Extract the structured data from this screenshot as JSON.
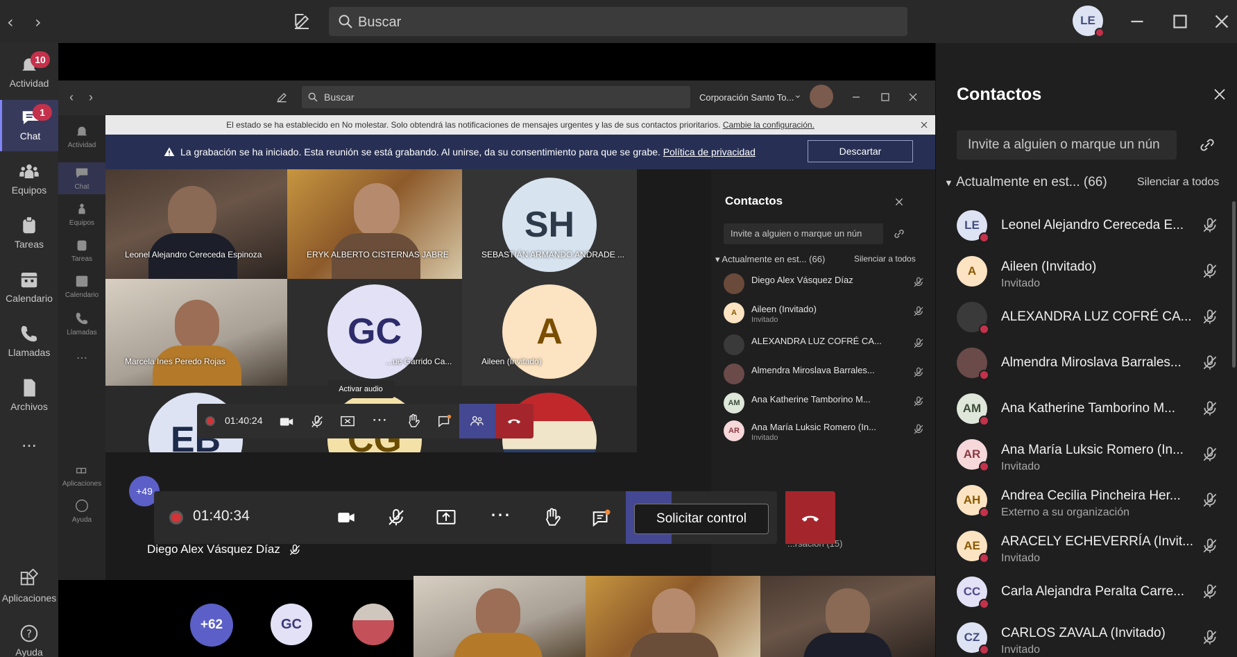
{
  "titlebar": {
    "search_placeholder": "Buscar",
    "user_initials": "LE"
  },
  "rail": {
    "items": [
      {
        "label": "Actividad",
        "icon": "bell-icon",
        "badge": "10"
      },
      {
        "label": "Chat",
        "icon": "chat-icon",
        "badge": "1"
      },
      {
        "label": "Equipos",
        "icon": "teams-icon",
        "badge": ""
      },
      {
        "label": "Tareas",
        "icon": "tasks-icon",
        "badge": ""
      },
      {
        "label": "Calendario",
        "icon": "calendar-icon",
        "badge": ""
      },
      {
        "label": "Llamadas",
        "icon": "phone-icon",
        "badge": ""
      },
      {
        "label": "Archivos",
        "icon": "files-icon",
        "badge": ""
      }
    ],
    "more": "...",
    "apps_label": "Aplicaciones",
    "help_label": "Ayuda"
  },
  "inner": {
    "search_placeholder": "Buscar",
    "org_name": "Corporación Santo To...",
    "rail": [
      "Actividad",
      "Chat",
      "Equipos",
      "Tareas",
      "Calendario",
      "Llamadas"
    ],
    "rail_apps": "Aplicaciones",
    "rail_help": "Ayuda",
    "dnd_text": "El estado se ha establecido en No molestar. Solo obtendrá las notificaciones de mensajes urgentes y las de sus contactos prioritarios.",
    "dnd_link": "Cambie la configuración.",
    "rec_bold": "La grabación se ha iniciado.",
    "rec_text": "Esta reunión se está grabando. Al unirse, da su consentimiento para que se grabe.",
    "rec_link": "Política de privacidad",
    "rec_button": "Descartar",
    "tiles": [
      {
        "name": "Leonel Alejandro Cereceda Espinoza"
      },
      {
        "name": "ERYK ALBERTO CISTERNAS JABRE"
      },
      {
        "name": "SEBASTIÁN ARMANDO ANDRADE ...",
        "initials": "SH"
      },
      {
        "name": "Marcela Ines Peredo Rojas"
      },
      {
        "name": "...ue Garrido Ca...",
        "initials": "GC"
      },
      {
        "name": "Aileen (Invitado)",
        "initials": "A"
      },
      {
        "name": "",
        "initials": "EB"
      },
      {
        "name": "",
        "initials": "CG"
      }
    ],
    "tooltip": "Activar audio",
    "timer": "01:40:24",
    "more_count": "+49",
    "contacts": {
      "title": "Contactos",
      "invite_placeholder": "Invite a alguien o marque un nún",
      "section": "Actualmente en est...",
      "count": "(66)",
      "mute_all": "Silenciar a todos",
      "rows": [
        {
          "name": "Diego Alex Vásquez Díaz",
          "sub": "",
          "initials": ""
        },
        {
          "name": "Aileen (Invitado)",
          "sub": "Invitado",
          "initials": "A"
        },
        {
          "name": "ALEXANDRA LUZ COFRÉ CA...",
          "sub": "",
          "initials": ""
        },
        {
          "name": "Almendra Miroslava Barrales...",
          "sub": "",
          "initials": ""
        },
        {
          "name": "Ana Katherine Tamborino M...",
          "sub": "",
          "initials": "AM"
        },
        {
          "name": "Ana María Luksic Romero (In...",
          "sub": "Invitado",
          "initials": "AR"
        }
      ],
      "footer_partial": "...rsación (15)"
    }
  },
  "controls": {
    "timer": "01:40:34",
    "request_control": "Solicitar control"
  },
  "speaker_name": "Diego Alex Vásquez Díaz",
  "bottom": {
    "more_count": "+62",
    "initials": "GC"
  },
  "contacts": {
    "title": "Contactos",
    "invite_placeholder": "Invite a alguien o marque un nún",
    "section": "Actualmente en est...",
    "count": "(66)",
    "mute_all": "Silenciar a todos",
    "rows": [
      {
        "name": "Leonel Alejandro Cereceda E...",
        "sub": "",
        "initials": "LE",
        "bg": "#dde3f3",
        "fg": "#444d7a"
      },
      {
        "name": "Aileen (Invitado)",
        "sub": "Invitado",
        "initials": "A",
        "bg": "#fce3c2",
        "fg": "#8a5a00"
      },
      {
        "name": "ALEXANDRA LUZ COFRÉ CA...",
        "sub": "",
        "initials": "",
        "bg": "#3a3a3a",
        "fg": "#fff"
      },
      {
        "name": "Almendra Miroslava Barrales...",
        "sub": "",
        "initials": "",
        "bg": "#6b4a4a",
        "fg": "#fff"
      },
      {
        "name": "Ana Katherine Tamborino M...",
        "sub": "",
        "initials": "AM",
        "bg": "#dfe6da",
        "fg": "#3b4b36"
      },
      {
        "name": "Ana María Luksic Romero (In...",
        "sub": "Invitado",
        "initials": "AR",
        "bg": "#f6d8da",
        "fg": "#8a3a42"
      },
      {
        "name": "Andrea Cecilia Pincheira Her...",
        "sub": "Externo a su organización",
        "initials": "AH",
        "bg": "#fce3c2",
        "fg": "#8a5a00"
      },
      {
        "name": "ARACELY ECHEVERRÍA (Invit...",
        "sub": "Invitado",
        "initials": "AE",
        "bg": "#fce3c2",
        "fg": "#8a5a00"
      },
      {
        "name": "Carla Alejandra Peralta Carre...",
        "sub": "",
        "initials": "CC",
        "bg": "#e2e1f5",
        "fg": "#4d4a8a"
      },
      {
        "name": "CARLOS ZAVALA (Invitado)",
        "sub": "Invitado",
        "initials": "CZ",
        "bg": "#dde3f3",
        "fg": "#444d7a"
      }
    ]
  },
  "colors": {
    "accent": "#7f85f5",
    "status_red": "#c4314b",
    "hangup": "#a4262c",
    "banner": "#273054"
  }
}
